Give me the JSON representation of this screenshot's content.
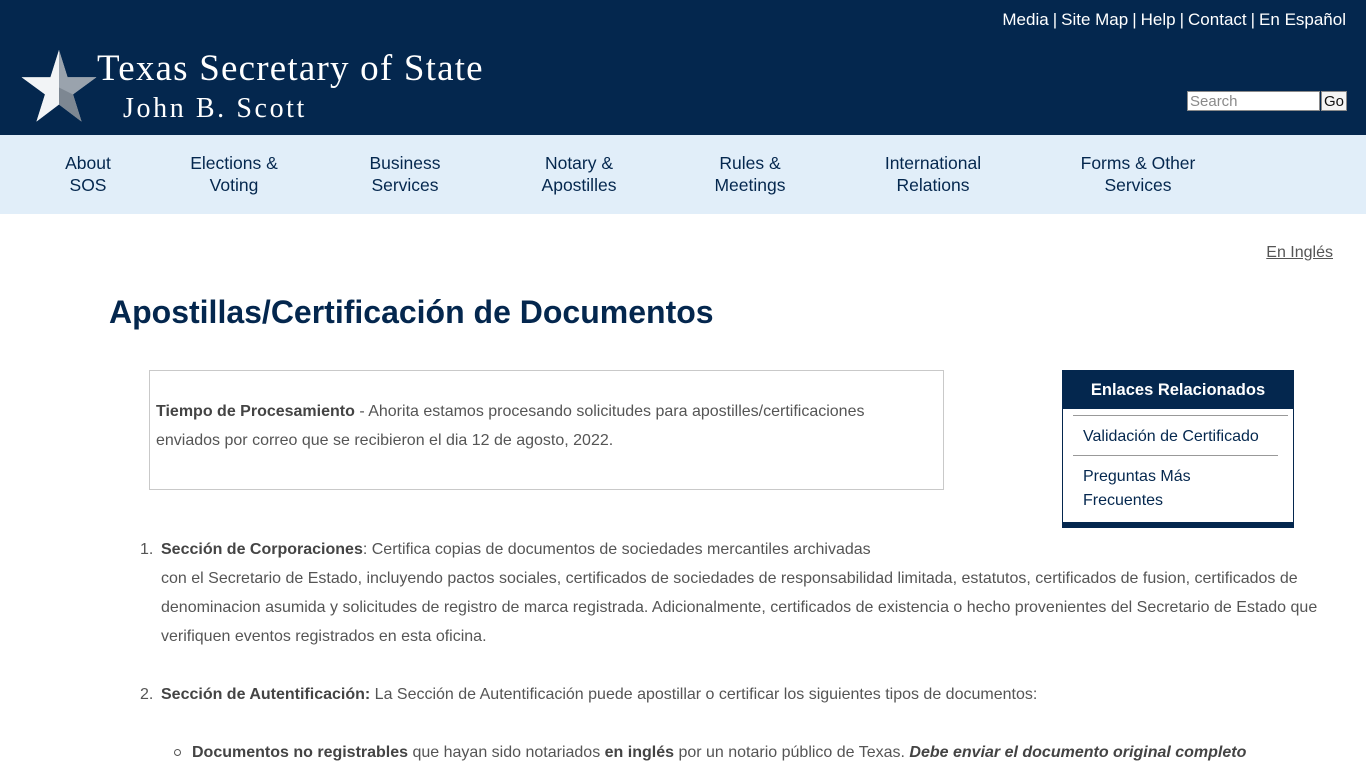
{
  "header": {
    "top_links": [
      "Media",
      "Site Map",
      "Help",
      "Contact",
      "En Español"
    ],
    "logo_title": "Texas Secretary of State",
    "logo_subtitle": "John B. Scott",
    "search_placeholder": "Search",
    "search_button": "Go"
  },
  "nav": {
    "items": [
      {
        "line1": "About",
        "line2": "SOS"
      },
      {
        "line1": "Elections &",
        "line2": "Voting"
      },
      {
        "line1": "Business",
        "line2": "Services"
      },
      {
        "line1": "Notary &",
        "line2": "Apostilles"
      },
      {
        "line1": "Rules &",
        "line2": "Meetings"
      },
      {
        "line1": "International",
        "line2": "Relations"
      },
      {
        "line1": "Forms & Other",
        "line2": "Services"
      }
    ]
  },
  "main": {
    "language_link": "En Inglés",
    "title": "Apostillas/Certificación de Documentos",
    "notice": {
      "label": "Tiempo de Procesamiento",
      "text_line1": " - Ahorita estamos procesando solicitudes para apostilles/certificaciones",
      "text_line2": "enviados por correo que se recibieron el dia 12 de agosto, 2022."
    },
    "related": {
      "heading": "Enlaces Relacionados",
      "links": [
        "Validación de Certificado",
        "Preguntas Más Frecuentes"
      ]
    },
    "list": {
      "item1_num": "1.",
      "item1_label": "Sección de Corporaciones",
      "item1_text": ": Certifica copias de documentos de sociedades mercantiles archivadas",
      "item1_rest": "con el Secretario de Estado, incluyendo pactos sociales, certificados de sociedades de responsabilidad limitada, estatutos, certificados de fusion, certificados de denominacion asumida y solicitudes de registro de marca registrada. Adicionalmente, certificados de existencia o hecho provenientes del Secretario de Estado que verifiquen eventos registrados en esta oficina.",
      "item2_num": "2.",
      "item2_label": "Sección de Autentificación:",
      "item2_text": " La Sección de Autentificación puede apostillar o certificar los siguientes tipos de documentos:",
      "sub_label": "Documentos no registrables",
      "sub_text1": " que hayan sido notariados ",
      "sub_bold": "en inglés",
      "sub_text2": " por un notario público de Texas. ",
      "sub_emph": "Debe enviar el documento original completo"
    }
  }
}
